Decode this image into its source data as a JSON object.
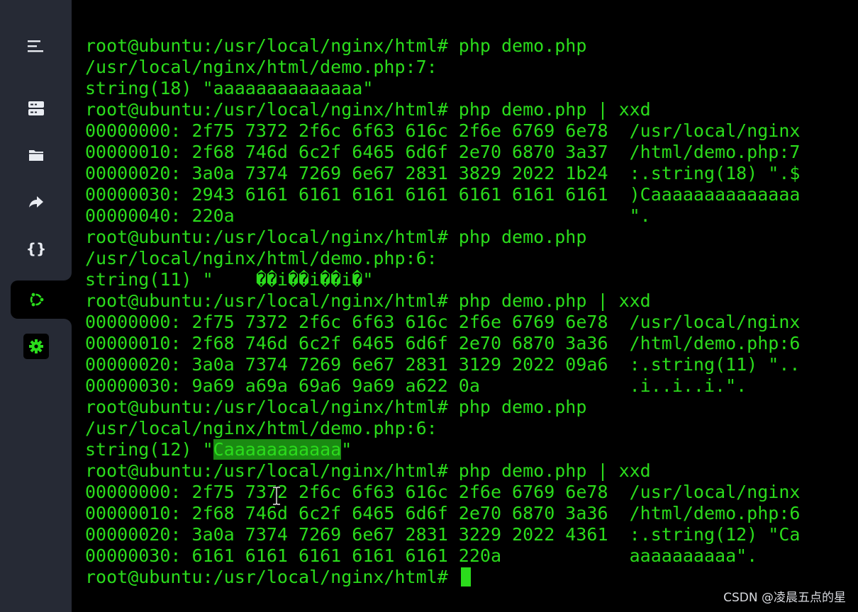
{
  "sidebar": {
    "icons": [
      {
        "name": "menu-icon"
      },
      {
        "name": "server-icon"
      },
      {
        "name": "folder-icon"
      },
      {
        "name": "share-icon"
      },
      {
        "name": "code-braces-icon",
        "glyph": "{}"
      },
      {
        "name": "ubuntu-icon",
        "active": true
      },
      {
        "name": "settings-icon"
      }
    ],
    "colors": {
      "background": "#262a35",
      "icon": "#e9ecf2",
      "accent": "#2bdc1c"
    }
  },
  "terminal": {
    "colors": {
      "text": "#2bdc1c",
      "background": "#000000",
      "selection": "#1a8a12"
    },
    "lines": [
      "root@ubuntu:/usr/local/nginx/html# php demo.php",
      "/usr/local/nginx/html/demo.php:7:",
      "string(18) \"aaaaaaaaaaaaaa\"",
      "root@ubuntu:/usr/local/nginx/html# php demo.php | xxd",
      "00000000: 2f75 7372 2f6c 6f63 616c 2f6e 6769 6e78  /usr/local/nginx",
      "00000010: 2f68 746d 6c2f 6465 6d6f 2e70 6870 3a37  /html/demo.php:7",
      "00000020: 3a0a 7374 7269 6e67 2831 3829 2022 1b24  :.string(18) \".$",
      "00000030: 2943 6161 6161 6161 6161 6161 6161 6161  )Caaaaaaaaaaaaaa",
      "00000040: 220a                                     \".",
      "root@ubuntu:/usr/local/nginx/html# php demo.php",
      "/usr/local/nginx/html/demo.php:6:",
      "string(11) \"    ��i��i��i�\"",
      "root@ubuntu:/usr/local/nginx/html# php demo.php | xxd",
      "00000000: 2f75 7372 2f6c 6f63 616c 2f6e 6769 6e78  /usr/local/nginx",
      "00000010: 2f68 746d 6c2f 6465 6d6f 2e70 6870 3a36  /html/demo.php:6",
      "00000020: 3a0a 7374 7269 6e67 2831 3129 2022 09a6  :.string(11) \"..",
      "00000030: 9a69 a69a 69a6 9a69 a622 0a              .i..i..i.\".",
      "root@ubuntu:/usr/local/nginx/html# php demo.php",
      "/usr/local/nginx/html/demo.php:6:"
    ],
    "selected_line": {
      "before": "string(12) \"",
      "selected": "Caaaaaaaaaaa",
      "after": "\""
    },
    "lines_after": [
      "root@ubuntu:/usr/local/nginx/html# php demo.php | xxd",
      "00000000: 2f75 7372 2f6c 6f63 616c 2f6e 6769 6e78  /usr/local/nginx",
      "00000010: 2f68 746d 6c2f 6465 6d6f 2e70 6870 3a36  /html/demo.php:6",
      "00000020: 3a0a 7374 7269 6e67 2831 3229 2022 4361  :.string(12) \"Ca",
      "00000030: 6161 6161 6161 6161 6161 220a            aaaaaaaaaa\"."
    ],
    "prompt": "root@ubuntu:/usr/local/nginx/html# "
  },
  "watermark": "CSDN @凌晨五点的星"
}
